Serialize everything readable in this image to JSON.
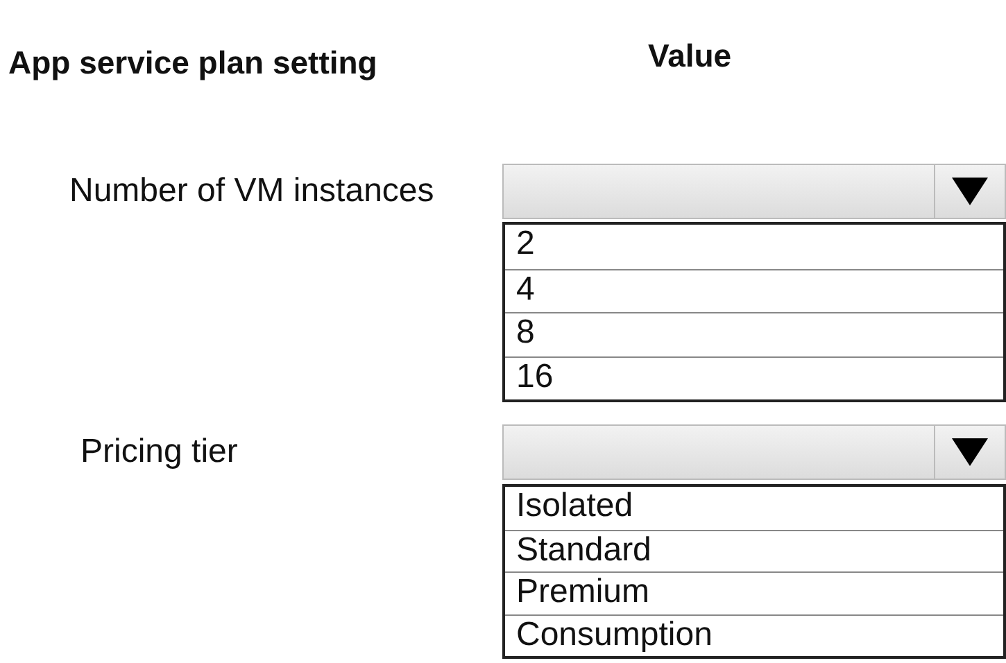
{
  "header": {
    "setting": "App service plan setting",
    "value": "Value"
  },
  "settings": [
    {
      "label": "Number of VM instances",
      "options": [
        "2",
        "4",
        "8",
        "16"
      ]
    },
    {
      "label": "Pricing tier",
      "options": [
        "Isolated",
        "Standard",
        "Premium",
        "Consumption"
      ]
    }
  ]
}
